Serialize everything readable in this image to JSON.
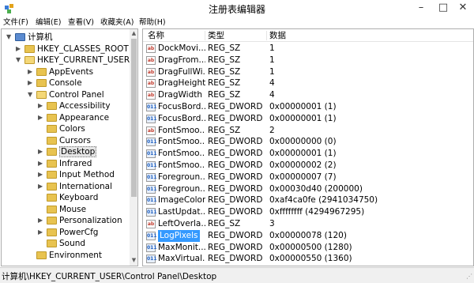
{
  "window": {
    "title": "注册表编辑器",
    "minimize": "–",
    "maximize": "□",
    "close": "✕"
  },
  "menu": [
    "文件(F)",
    "编辑(E)",
    "查看(V)",
    "收藏夹(A)",
    "帮助(H)"
  ],
  "tree": [
    {
      "label": "计算机",
      "level": 0,
      "expander": "▼",
      "kind": "computer"
    },
    {
      "label": "HKEY_CLASSES_ROOT",
      "level": 1,
      "expander": "▶",
      "kind": "folder"
    },
    {
      "label": "HKEY_CURRENT_USER",
      "level": 1,
      "expander": "▼",
      "kind": "folder-open"
    },
    {
      "label": "AppEvents",
      "level": 2,
      "expander": "▶",
      "kind": "folder"
    },
    {
      "label": "Console",
      "level": 2,
      "expander": "▶",
      "kind": "folder"
    },
    {
      "label": "Control Panel",
      "level": 2,
      "expander": "▼",
      "kind": "folder-open"
    },
    {
      "label": "Accessibility",
      "level": 3,
      "expander": "▶",
      "kind": "folder"
    },
    {
      "label": "Appearance",
      "level": 3,
      "expander": "▶",
      "kind": "folder"
    },
    {
      "label": "Colors",
      "level": 3,
      "expander": "",
      "kind": "folder"
    },
    {
      "label": "Cursors",
      "level": 3,
      "expander": "",
      "kind": "folder"
    },
    {
      "label": "Desktop",
      "level": 3,
      "expander": "▶",
      "kind": "folder",
      "selected": true
    },
    {
      "label": "Infrared",
      "level": 3,
      "expander": "▶",
      "kind": "folder"
    },
    {
      "label": "Input Method",
      "level": 3,
      "expander": "▶",
      "kind": "folder"
    },
    {
      "label": "International",
      "level": 3,
      "expander": "▶",
      "kind": "folder"
    },
    {
      "label": "Keyboard",
      "level": 3,
      "expander": "",
      "kind": "folder"
    },
    {
      "label": "Mouse",
      "level": 3,
      "expander": "",
      "kind": "folder"
    },
    {
      "label": "Personalization",
      "level": 3,
      "expander": "▶",
      "kind": "folder"
    },
    {
      "label": "PowerCfg",
      "level": 3,
      "expander": "▶",
      "kind": "folder"
    },
    {
      "label": "Sound",
      "level": 3,
      "expander": "",
      "kind": "folder"
    },
    {
      "label": "Environment",
      "level": 2,
      "expander": "",
      "kind": "folder"
    }
  ],
  "columns": {
    "name": "名称",
    "type": "类型",
    "data": "数据"
  },
  "values": [
    {
      "name": "DockMovi...",
      "type": "REG_SZ",
      "data": "1",
      "icon": "sz"
    },
    {
      "name": "DragFrom...",
      "type": "REG_SZ",
      "data": "1",
      "icon": "sz"
    },
    {
      "name": "DragFullWi...",
      "type": "REG_SZ",
      "data": "1",
      "icon": "sz"
    },
    {
      "name": "DragHeight",
      "type": "REG_SZ",
      "data": "4",
      "icon": "sz"
    },
    {
      "name": "DragWidth",
      "type": "REG_SZ",
      "data": "4",
      "icon": "sz"
    },
    {
      "name": "FocusBord...",
      "type": "REG_DWORD",
      "data": "0x00000001 (1)",
      "icon": "dw"
    },
    {
      "name": "FocusBord...",
      "type": "REG_DWORD",
      "data": "0x00000001 (1)",
      "icon": "dw"
    },
    {
      "name": "FontSmoo...",
      "type": "REG_SZ",
      "data": "2",
      "icon": "sz"
    },
    {
      "name": "FontSmoo...",
      "type": "REG_DWORD",
      "data": "0x00000000 (0)",
      "icon": "dw"
    },
    {
      "name": "FontSmoo...",
      "type": "REG_DWORD",
      "data": "0x00000001 (1)",
      "icon": "dw"
    },
    {
      "name": "FontSmoo...",
      "type": "REG_DWORD",
      "data": "0x00000002 (2)",
      "icon": "dw"
    },
    {
      "name": "Foregroun...",
      "type": "REG_DWORD",
      "data": "0x00000007 (7)",
      "icon": "dw"
    },
    {
      "name": "Foregroun...",
      "type": "REG_DWORD",
      "data": "0x00030d40 (200000)",
      "icon": "dw"
    },
    {
      "name": "ImageColor",
      "type": "REG_DWORD",
      "data": "0xaf4ca0fe (2941034750)",
      "icon": "dw"
    },
    {
      "name": "LastUpdat...",
      "type": "REG_DWORD",
      "data": "0xffffffff (4294967295)",
      "icon": "dw"
    },
    {
      "name": "LeftOverla...",
      "type": "REG_SZ",
      "data": "3",
      "icon": "sz"
    },
    {
      "name": "LogPixels",
      "type": "REG_DWORD",
      "data": "0x00000078 (120)",
      "icon": "dw",
      "selected": true
    },
    {
      "name": "MaxMonit...",
      "type": "REG_DWORD",
      "data": "0x00000500 (1280)",
      "icon": "dw"
    },
    {
      "name": "MaxVirtual...",
      "type": "REG_DWORD",
      "data": "0x00000550 (1360)",
      "icon": "dw"
    }
  ],
  "icons": {
    "sz": "ab",
    "dw": "011"
  },
  "status": "计算机\\HKEY_CURRENT_USER\\Control Panel\\Desktop"
}
